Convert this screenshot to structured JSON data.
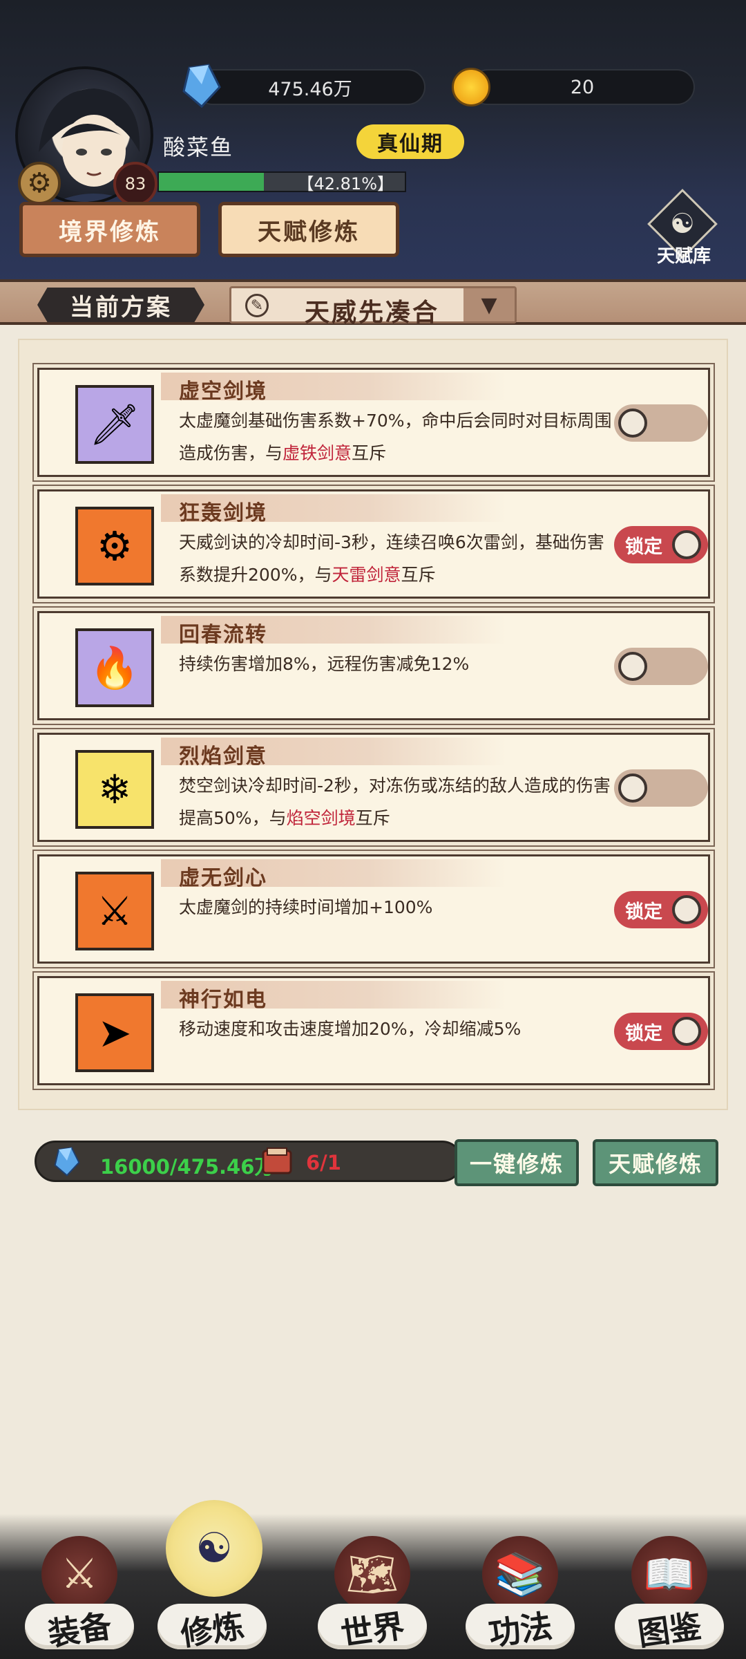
{
  "header": {
    "crystal_amount": "475.46万",
    "coin_amount": "20",
    "player_name": "酸菜鱼",
    "realm": "真仙期",
    "level": "83",
    "exp_percent_text": "【42.81%】",
    "exp_progress": 0.4281,
    "tabs": [
      "境界修炼",
      "天赋修炼"
    ],
    "talent_library": "天赋库"
  },
  "scheme": {
    "label": "当前方案",
    "name": "天威先凑合"
  },
  "talents": [
    {
      "title": "虚空剑境",
      "icon": "sword-icon",
      "icon_color": "#b9a6e6",
      "desc_pre": "太虚魔剑基础伤害系数+70%，命中后会同时对目标周围造成伤害，与",
      "desc_hl": "虚铁剑意",
      "desc_post": "互斥",
      "locked": false,
      "toggle_label": ""
    },
    {
      "title": "狂轰剑境",
      "icon": "blade-ring-icon",
      "icon_color": "#f0782e",
      "desc_pre": "天威剑诀的冷却时间-3秒，连续召唤6次雷剑，基础伤害系数提升200%，与",
      "desc_hl": "天雷剑意",
      "desc_post": "互斥",
      "locked": true,
      "toggle_label": "锁定"
    },
    {
      "title": "回春流转",
      "icon": "flame-blood-icon",
      "icon_color": "#b9a6e6",
      "desc_pre": "持续伤害增加8%，远程伤害减免12%",
      "desc_hl": "",
      "desc_post": "",
      "locked": false,
      "toggle_label": ""
    },
    {
      "title": "烈焰剑意",
      "icon": "fire-ice-icon",
      "icon_color": "#f7e36b",
      "desc_pre": "焚空剑诀冷却时间-2秒，对冻伤或冻结的敌人造成的伤害提高50%，与",
      "desc_hl": "焰空剑境",
      "desc_post": "互斥",
      "locked": false,
      "toggle_label": ""
    },
    {
      "title": "虚无剑心",
      "icon": "dark-sword-icon",
      "icon_color": "#f0782e",
      "desc_pre": "太虚魔剑的持续时间增加+100%",
      "desc_hl": "",
      "desc_post": "",
      "locked": true,
      "toggle_label": "锁定"
    },
    {
      "title": "神行如电",
      "icon": "lightning-arrow-icon",
      "icon_color": "#f0782e",
      "desc_pre": "移动速度和攻击速度增加20%，冷却缩减5%",
      "desc_hl": "",
      "desc_post": "",
      "locked": true,
      "toggle_label": "锁定"
    }
  ],
  "cost": {
    "crystal": "16000/475.46万",
    "scroll": "6/1"
  },
  "actions": {
    "one_click": "一键修炼",
    "talent_train": "天赋修炼"
  },
  "nav": [
    "装备",
    "修炼",
    "世界",
    "功法",
    "图鉴"
  ]
}
